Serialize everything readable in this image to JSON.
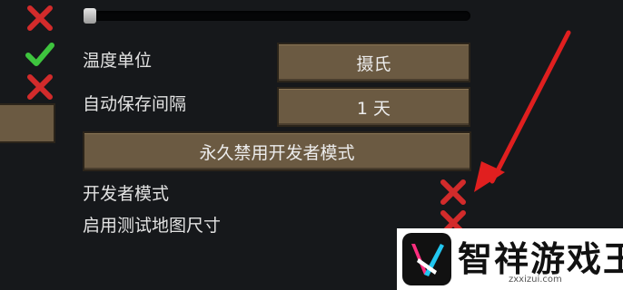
{
  "settings": {
    "temperature_unit": {
      "label": "温度单位",
      "value": "摄氏"
    },
    "autosave_interval": {
      "label": "自动保存间隔",
      "value": "1 天"
    },
    "disable_dev_mode_button": "永久禁用开发者模式",
    "developer_mode": {
      "label": "开发者模式"
    },
    "test_map_sizes": {
      "label": "启用测试地图尺寸"
    }
  },
  "slider": {
    "value": 0
  },
  "watermark": {
    "title": "智祥游戏王",
    "url": "zxxizui.com"
  },
  "colors": {
    "background": "#16181b",
    "button": "#6b5a42",
    "x_mark": "#d22b2b",
    "check_mark": "#3ec43e",
    "arrow": "#e01f1f"
  }
}
